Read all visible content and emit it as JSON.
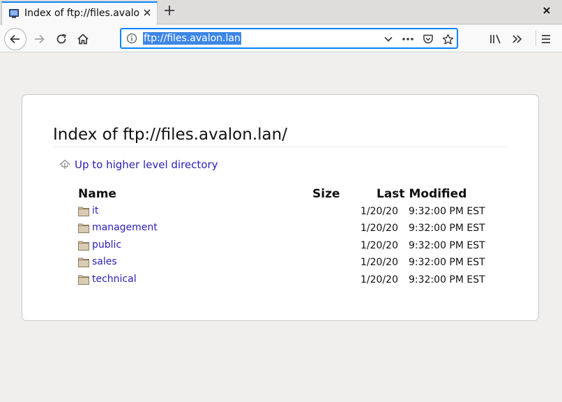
{
  "browser": {
    "tab": {
      "title": "Index of ftp://files.avalon.lan/"
    },
    "url": "ftp://files.avalon.lan",
    "colors": {
      "accent": "#0a84ff",
      "link": "#2a20b8",
      "selection": "#3d86e6"
    },
    "icons": [
      "favicon-icon",
      "tab-close-icon",
      "plus-icon",
      "window-close-icon",
      "back-arrow-icon",
      "forward-arrow-icon",
      "reload-icon",
      "home-icon",
      "info-icon",
      "dropdown-chevron-icon",
      "page-actions-icon",
      "pocket-icon",
      "star-icon",
      "library-icon",
      "overflow-chevrons-icon",
      "hamburger-menu-icon"
    ]
  },
  "page": {
    "heading": "Index of ftp://files.avalon.lan/",
    "up_link": "Up to higher level directory",
    "columns": {
      "name": "Name",
      "size": "Size",
      "modified": "Last Modified"
    },
    "rows": [
      {
        "name": "it",
        "size": "",
        "date": "1/20/20",
        "time": "9:32:00 PM EST"
      },
      {
        "name": "management",
        "size": "",
        "date": "1/20/20",
        "time": "9:32:00 PM EST"
      },
      {
        "name": "public",
        "size": "",
        "date": "1/20/20",
        "time": "9:32:00 PM EST"
      },
      {
        "name": "sales",
        "size": "",
        "date": "1/20/20",
        "time": "9:32:00 PM EST"
      },
      {
        "name": "technical",
        "size": "",
        "date": "1/20/20",
        "time": "9:32:00 PM EST"
      }
    ]
  }
}
